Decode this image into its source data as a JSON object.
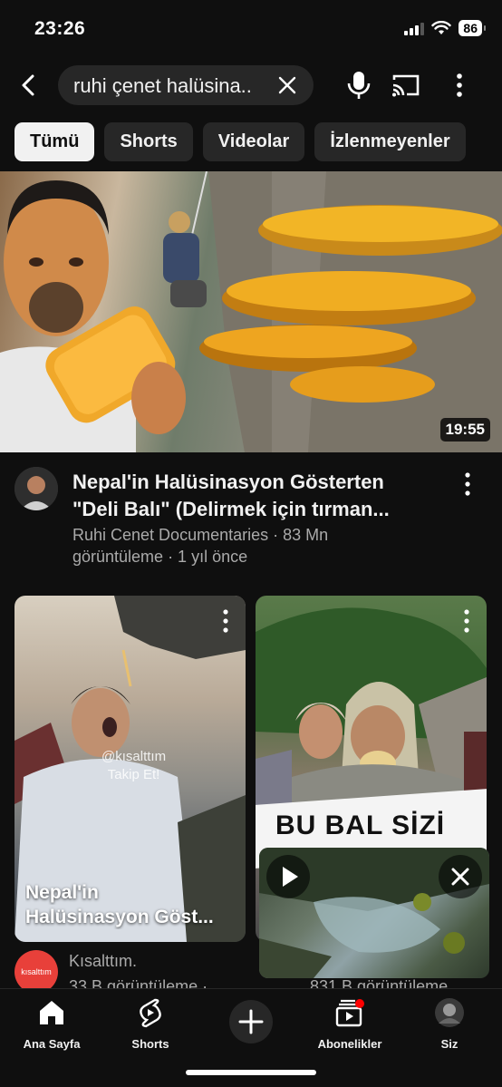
{
  "status_bar": {
    "time": "23:26",
    "battery": "86",
    "icons": [
      "signal-icon",
      "wifi-icon",
      "battery-icon"
    ]
  },
  "search": {
    "query": "ruhi çenet halüsina..",
    "icons": [
      "back-arrow-icon",
      "clear-icon",
      "microphone-icon",
      "cast-icon",
      "more-vert-icon"
    ]
  },
  "chips": [
    "Tümü",
    "Shorts",
    "Videolar",
    "İzlenmeyenler"
  ],
  "main_video": {
    "duration": "19:55",
    "title_line1": "Nepal'in Halüsinasyon Gösterten",
    "title_line2": "\"Deli Balı\" (Delirmek için tırman...",
    "meta_line1": "Ruhi Cenet Documentaries · 83 Mn",
    "meta_line2": "görüntüleme · 1 yıl önce"
  },
  "shorts": [
    {
      "title_line1": "Nepal'in",
      "title_line2": "Halüsinasyon Göst...",
      "watermark_line1": "@kısalttım",
      "watermark_line2": "Takip Et!",
      "channel": "Kısalttım.",
      "channel_avatar_text": "kısalttım",
      "views": "33 B görüntüleme ·"
    },
    {
      "banner": "BU BAL SİZİ",
      "views": "831 B görüntüleme"
    }
  ],
  "bottom_nav": [
    {
      "label": "Ana Sayfa",
      "icon": "home-icon"
    },
    {
      "label": "Shorts",
      "icon": "shorts-icon"
    },
    {
      "label": "",
      "icon": "plus-icon"
    },
    {
      "label": "Abonelikler",
      "icon": "subscriptions-icon"
    },
    {
      "label": "Siz",
      "icon": "profile-avatar"
    }
  ],
  "colors": {
    "background": "#0f0f0f",
    "chip": "#272727",
    "chip_active": "#f1f1f1",
    "meta_text": "#aaaaaa",
    "notification_dot": "#ff0000"
  }
}
